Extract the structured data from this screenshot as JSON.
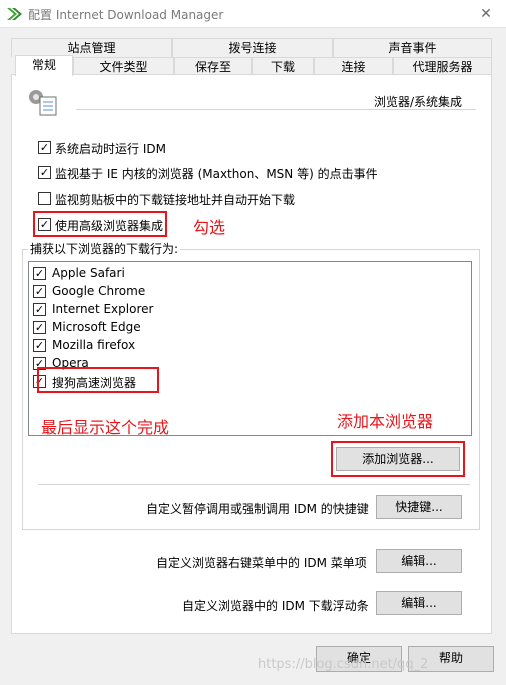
{
  "window": {
    "title": "配置 Internet Download Manager",
    "close_label": "✕"
  },
  "tabs_row1": [
    {
      "label": "站点管理"
    },
    {
      "label": "拨号连接"
    },
    {
      "label": "声音事件"
    }
  ],
  "tabs_row2": [
    {
      "label": "常规"
    },
    {
      "label": "文件类型"
    },
    {
      "label": "保存至"
    },
    {
      "label": "下载"
    },
    {
      "label": "连接"
    },
    {
      "label": "代理服务器"
    }
  ],
  "section_heading": "浏览器/系统集成",
  "options": [
    {
      "label": "系统启动时运行 IDM",
      "checked": true
    },
    {
      "label": "监视基于 IE 内核的浏览器 (Maxthon、MSN 等) 的点击事件",
      "checked": true
    },
    {
      "label": "监视剪贴板中的下载链接地址并自动开始下载",
      "checked": false
    },
    {
      "label": "使用高级浏览器集成",
      "checked": true
    }
  ],
  "capture_group_label": "捕获以下浏览器的下载行为:",
  "browsers": [
    {
      "label": "Apple Safari",
      "checked": true
    },
    {
      "label": "Google Chrome",
      "checked": true
    },
    {
      "label": "Internet Explorer",
      "checked": true
    },
    {
      "label": "Microsoft Edge",
      "checked": true
    },
    {
      "label": "Mozilla firefox",
      "checked": true
    },
    {
      "label": "Opera",
      "checked": true
    },
    {
      "label": "搜狗高速浏览器",
      "checked": true
    }
  ],
  "check_mark": "✓",
  "add_browser_button": "添加浏览器...",
  "hotkey_row": {
    "label": "自定义暂停调用或强制调用 IDM 的快捷键",
    "button": "快捷键..."
  },
  "context_menu_row": {
    "label": "自定义浏览器右键菜单中的 IDM 菜单项",
    "button": "编辑..."
  },
  "float_bar_row": {
    "label": "自定义浏览器中的 IDM 下载浮动条",
    "button": "编辑..."
  },
  "footer": {
    "ok": "确定",
    "help": "帮助"
  },
  "annotations": {
    "check_note": "勾选",
    "done_note": "最后显示这个完成",
    "add_note": "添加本浏览器"
  },
  "watermark": "https://blog.csdn.net/qq_2",
  "colors": {
    "annotation": "#e8161b",
    "idm_green": "#3fa535"
  }
}
